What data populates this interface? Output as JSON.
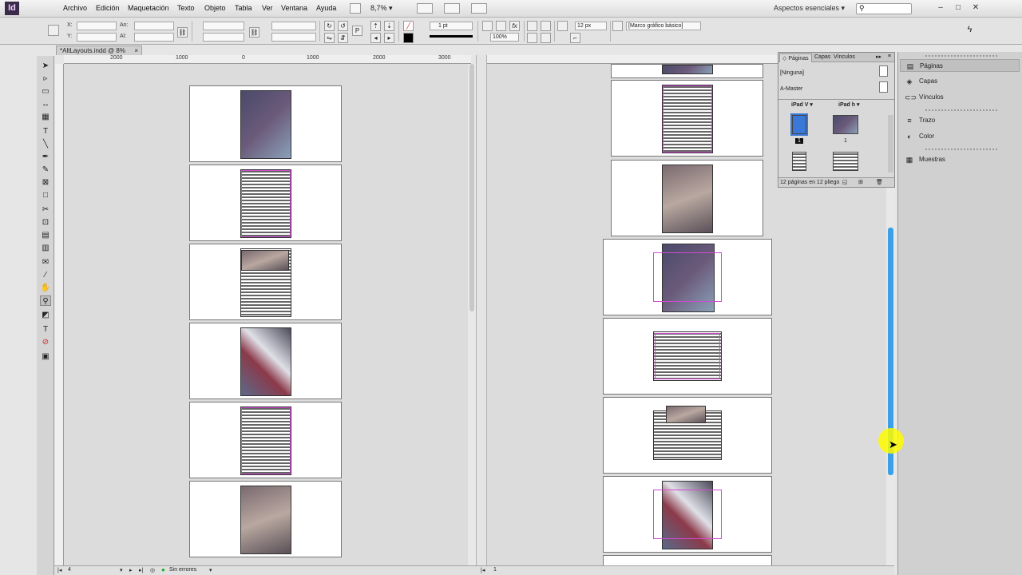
{
  "app": {
    "logo": "Id",
    "menu": [
      "Archivo",
      "Edición",
      "Maquetación",
      "Texto",
      "Objeto",
      "Tabla",
      "Ver",
      "Ventana",
      "Ayuda"
    ],
    "zoom": "8,7%",
    "workspace": "Aspectos esenciales",
    "window_controls": [
      "–",
      "□",
      "✕"
    ]
  },
  "control_bar": {
    "x_label": "X:",
    "y_label": "Y:",
    "w_label": "An:",
    "h_label": "Al:",
    "stroke_weight": "1 pt",
    "scale": "100%",
    "spacing": "12 px",
    "frame_style": "[Marco gráfico básico]"
  },
  "document": {
    "tab_title": "*AltLayouts.indd @ 8%",
    "tab_close": "×"
  },
  "rulers": {
    "left_ticks": [
      "2000",
      "1000",
      "0",
      "1000",
      "2000",
      "3000"
    ],
    "right_ticks": []
  },
  "statusbar": {
    "page": "4",
    "errors": "Sin errores",
    "page_right": "1"
  },
  "pages_panel": {
    "tabs": [
      "Páginas",
      "Capas",
      "Vínculos"
    ],
    "masters": [
      "[Ninguna]",
      "A-Master"
    ],
    "layout_left": "iPad V",
    "layout_right": "iPad h",
    "page_label_left": "1",
    "page_label_right": "1",
    "footer": "12 páginas en 12 pliego"
  },
  "dock": {
    "items": [
      "Páginas",
      "Capas",
      "Vínculos",
      "Trazo",
      "Color",
      "Muestras"
    ]
  }
}
